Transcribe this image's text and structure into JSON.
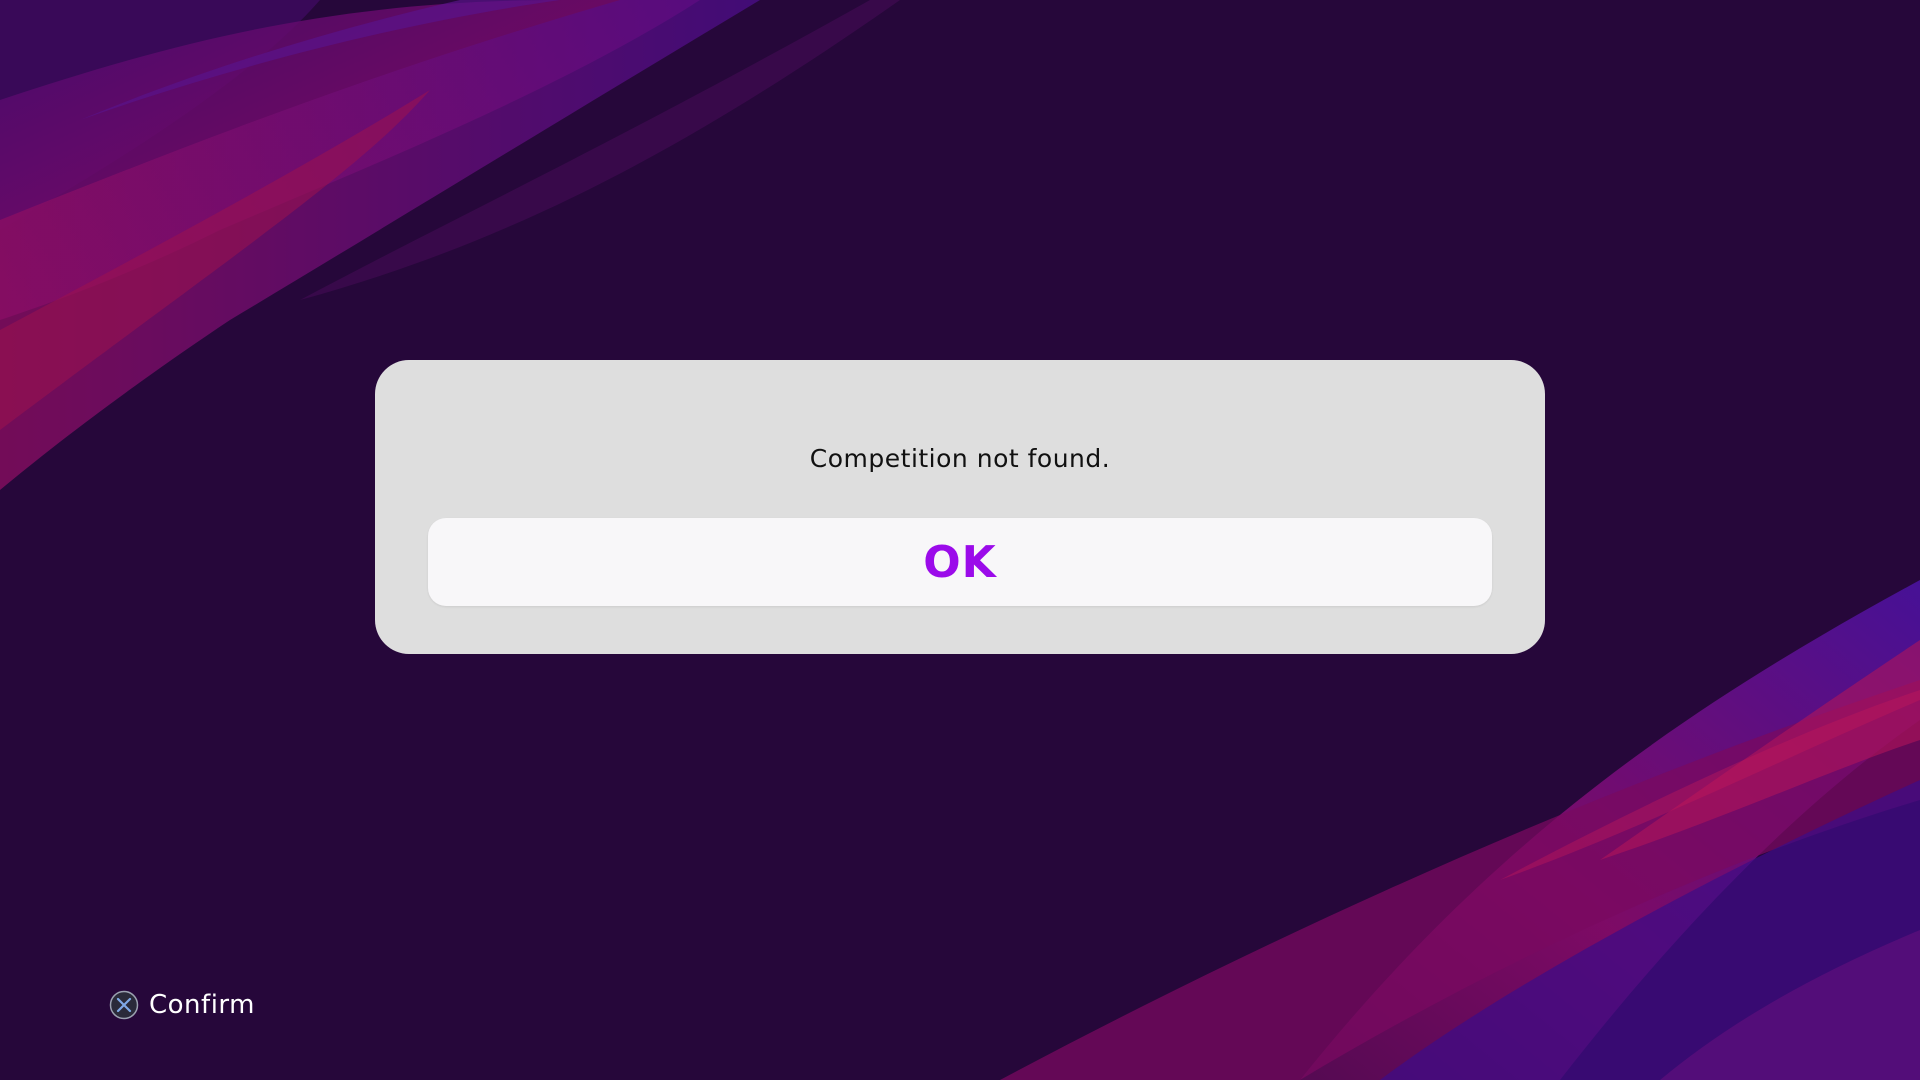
{
  "dialog": {
    "message": "Competition not found.",
    "ok_label": "OK",
    "accent_color": "#9b0bea"
  },
  "footer": {
    "confirm_icon": "cross-button-icon",
    "confirm_label": "Confirm"
  },
  "theme": {
    "background": "#26073a",
    "dialog_background": "#dedede",
    "button_background": "#f8f7f9"
  }
}
